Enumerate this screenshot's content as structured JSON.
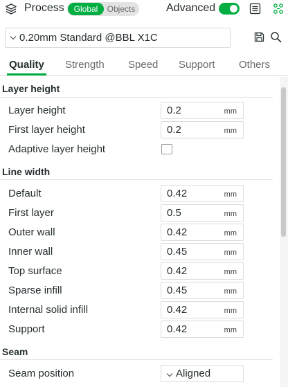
{
  "header": {
    "title": "Process",
    "segment": {
      "active": "Global",
      "inactive": "Objects"
    },
    "advanced_label": "Advanced",
    "advanced_enabled": true,
    "icons": [
      "layers-icon",
      "list-icon",
      "compare-icon"
    ]
  },
  "preset": {
    "name": "0.20mm Standard @BBL X1C"
  },
  "tabs": [
    {
      "label": "Quality",
      "active": true
    },
    {
      "label": "Strength",
      "active": false
    },
    {
      "label": "Speed",
      "active": false
    },
    {
      "label": "Support",
      "active": false
    },
    {
      "label": "Others",
      "active": false
    }
  ],
  "sections": {
    "layer_height": {
      "title": "Layer height",
      "layer_height": {
        "label": "Layer height",
        "value": "0.2",
        "unit": "mm"
      },
      "first_layer_height": {
        "label": "First layer height",
        "value": "0.2",
        "unit": "mm"
      },
      "adaptive": {
        "label": "Adaptive layer height",
        "checked": false
      }
    },
    "line_width": {
      "title": "Line width",
      "rows": [
        {
          "label": "Default",
          "value": "0.42",
          "unit": "mm"
        },
        {
          "label": "First layer",
          "value": "0.5",
          "unit": "mm"
        },
        {
          "label": "Outer wall",
          "value": "0.42",
          "unit": "mm"
        },
        {
          "label": "Inner wall",
          "value": "0.45",
          "unit": "mm"
        },
        {
          "label": "Top surface",
          "value": "0.42",
          "unit": "mm"
        },
        {
          "label": "Sparse infill",
          "value": "0.45",
          "unit": "mm"
        },
        {
          "label": "Internal solid infill",
          "value": "0.42",
          "unit": "mm"
        },
        {
          "label": "Support",
          "value": "0.42",
          "unit": "mm"
        }
      ]
    },
    "seam": {
      "title": "Seam",
      "position": {
        "label": "Seam position",
        "value": "Aligned"
      }
    }
  },
  "colors": {
    "accent": "#00ae42",
    "text": "#262e30",
    "muted": "#6b6b6b"
  }
}
